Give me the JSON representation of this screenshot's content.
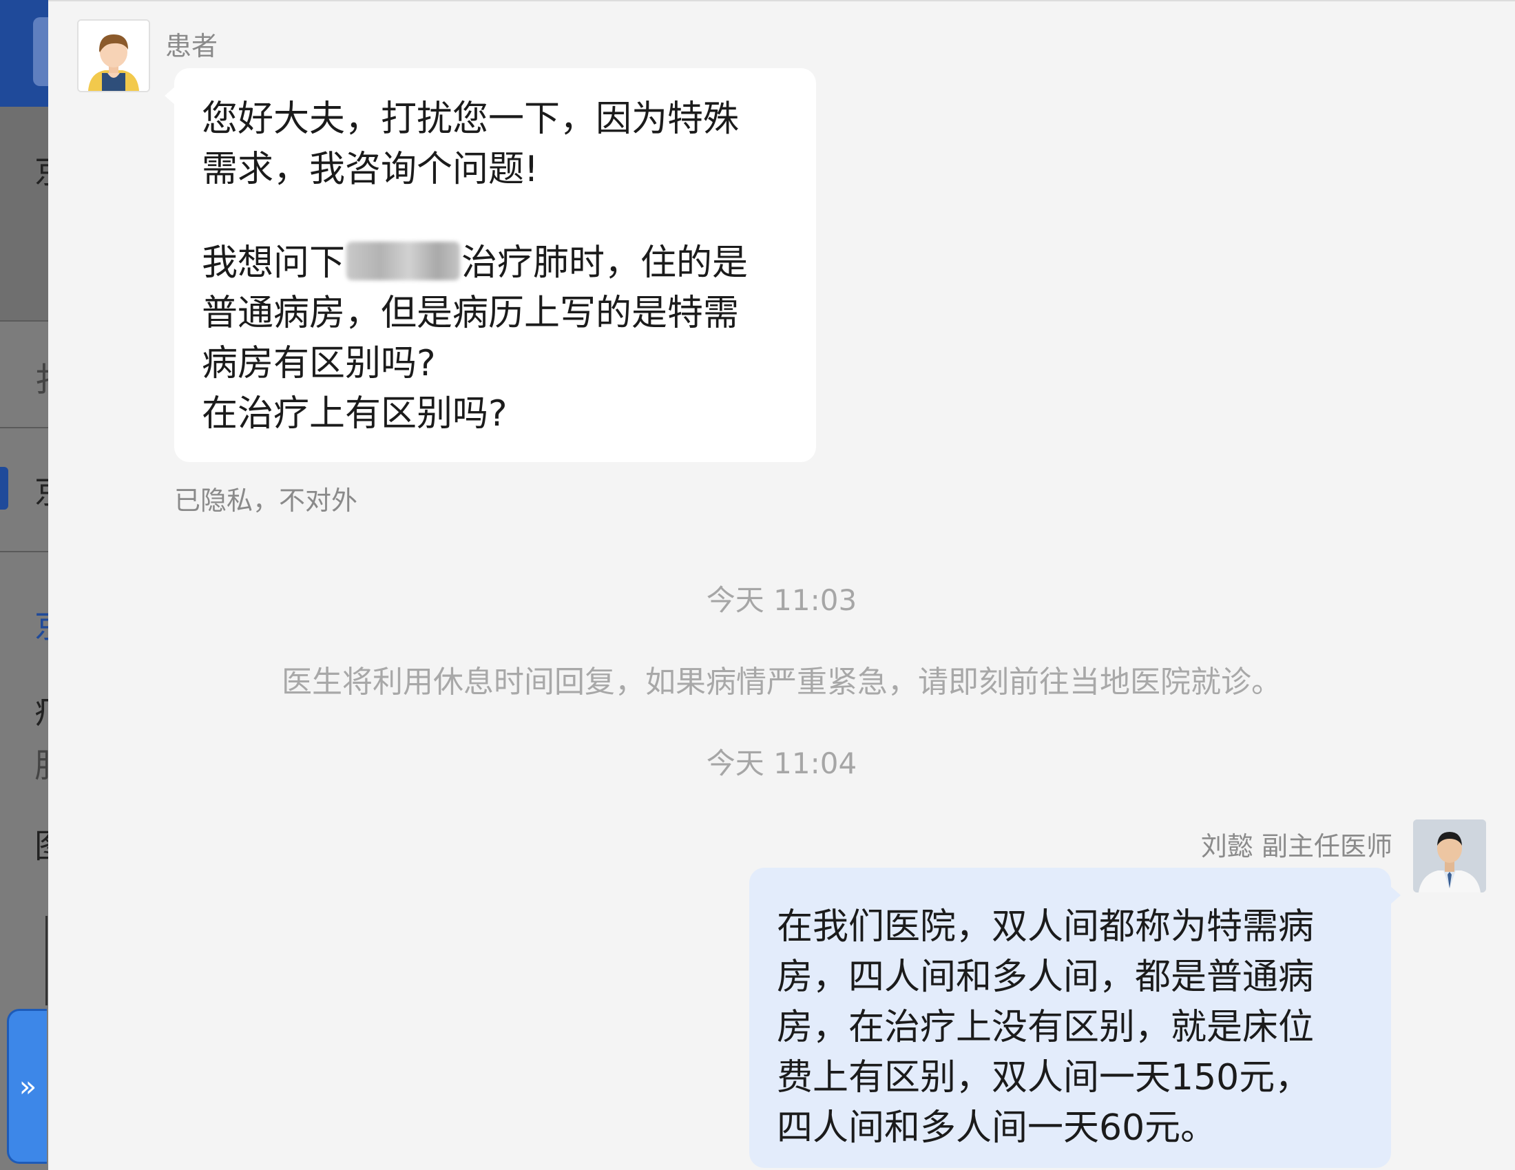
{
  "background_left": {
    "glyphs": [
      "京",
      "扌",
      "京",
      "京",
      "疒",
      "肝",
      "图"
    ]
  },
  "expand_button": {
    "icon": "»"
  },
  "patient": {
    "name": "患者",
    "avatar_icon": "patient-avatar-icon",
    "message": {
      "para1": "您好大夫，打扰您一下，因为特殊\n需求，我咨询个问题!",
      "para2_prefix": "我想问下",
      "para2_suffix": "治疗肺时，住的是\n普通病房，但是病历上写的是特需\n病房有区别吗?\n在治疗上有区别吗?"
    },
    "privacy_note": "已隐私，不对外"
  },
  "timestamps": [
    "今天 11:03",
    "今天 11:04"
  ],
  "system_notice": "医生将利用休息时间回复，如果病情严重紧急，请即刻前往当地医院就诊。",
  "doctor": {
    "name": "刘懿 副主任医师",
    "avatar_icon": "doctor-avatar-icon",
    "message": "在我们医院，双人间都称为特需病\n房，四人间和多人间，都是普通病\n房，在治疗上没有区别，就是床位\n费上有区别，双人间一天150元，\n四人间和多人间一天60元。"
  },
  "colors": {
    "patient_bubble": "#ffffff",
    "doctor_bubble": "#e3ecfb",
    "chat_bg": "#f4f4f4",
    "brand_blue": "#1f4a9a",
    "expand_blue": "#3d87e8"
  }
}
